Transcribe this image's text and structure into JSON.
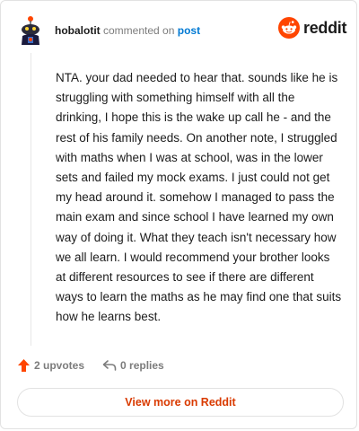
{
  "header": {
    "username": "hobalotit",
    "action": "commented on",
    "link": "post"
  },
  "brand": {
    "name": "reddit",
    "color": "#ff4500"
  },
  "comment": {
    "text": "NTA. your dad needed to hear that. sounds like he is struggling with something himself with all the drinking, I hope this is the wake up call he - and the rest of his family needs. On another note, I struggled with maths when I was at school, was in the lower sets and failed my mock exams. I just could not get my head around it. somehow I managed to pass the main exam and since school I have learned my own way of doing it. What they teach isn't necessary how we all learn. I would recommend your brother looks at different resources to see if there are different ways to learn the maths as he may find one that suits how he learns best."
  },
  "actions": {
    "upvotes": "2 upvotes",
    "replies": "0 replies"
  },
  "footer": {
    "button_label": "View more on Reddit"
  },
  "colors": {
    "accent": "#d93a00",
    "upvote": "#ff4500",
    "link": "#0079d3"
  }
}
